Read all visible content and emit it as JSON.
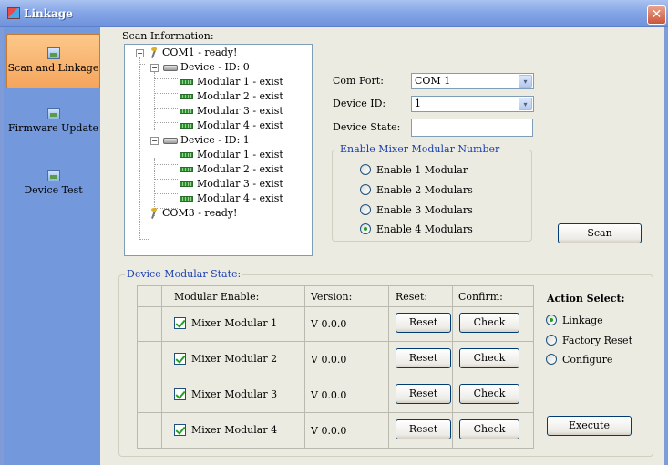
{
  "window": {
    "title": "Linkage",
    "close_glyph": "✕"
  },
  "sidebar": {
    "items": [
      {
        "label": "Scan and Linkage",
        "icon": "image-icon",
        "active": true
      },
      {
        "label": "Firmware Update",
        "icon": "image-icon",
        "active": false
      },
      {
        "label": "Device Test",
        "icon": "image-icon",
        "active": false
      }
    ]
  },
  "scan": {
    "section_label": "Scan Information:",
    "tree": [
      {
        "label": "COM1 - ready!"
      },
      {
        "label": "Device - ID: 0"
      },
      {
        "label": "Modular 1 - exist"
      },
      {
        "label": "Modular 2 - exist"
      },
      {
        "label": "Modular 3 - exist"
      },
      {
        "label": "Modular 4 - exist"
      },
      {
        "label": "Device - ID: 1"
      },
      {
        "label": "Modular 1 - exist"
      },
      {
        "label": "Modular 2 - exist"
      },
      {
        "label": "Modular 3 - exist"
      },
      {
        "label": "Modular 4 - exist"
      },
      {
        "label": "COM3 - ready!"
      }
    ],
    "expander_glyph": "−",
    "com_port_label": "Com Port:",
    "com_port_value": "COM 1",
    "device_id_label": "Device ID:",
    "device_id_value": "1",
    "device_state_label": "Device State:",
    "device_state_value": "",
    "dropdown_glyph": "▾",
    "mixer_group_title": "Enable Mixer Modular Number",
    "mixer_options": [
      {
        "label": "Enable 1 Modular",
        "selected": false
      },
      {
        "label": "Enable 2 Modulars",
        "selected": false
      },
      {
        "label": "Enable 3 Modulars",
        "selected": false
      },
      {
        "label": "Enable 4 Modulars",
        "selected": true
      }
    ],
    "scan_button": "Scan"
  },
  "modular_state": {
    "group_title": "Device Modular State:",
    "headers": {
      "enable": "Modular Enable:",
      "version": "Version:",
      "reset": "Reset:",
      "confirm": "Confirm:"
    },
    "rows": [
      {
        "name": "Mixer Modular 1",
        "checked": true,
        "version": "V 0.0.0",
        "reset": "Reset",
        "confirm": "Check"
      },
      {
        "name": "Mixer Modular 2",
        "checked": true,
        "version": "V 0.0.0",
        "reset": "Reset",
        "confirm": "Check"
      },
      {
        "name": "Mixer Modular 3",
        "checked": true,
        "version": "V 0.0.0",
        "reset": "Reset",
        "confirm": "Check"
      },
      {
        "name": "Mixer Modular 4",
        "checked": true,
        "version": "V 0.0.0",
        "reset": "Reset",
        "confirm": "Check"
      }
    ],
    "action_title": "Action Select:",
    "actions": [
      {
        "label": "Linkage",
        "selected": true
      },
      {
        "label": "Factory Reset",
        "selected": false
      },
      {
        "label": "Configure",
        "selected": false
      }
    ],
    "execute_button": "Execute"
  },
  "colors": {
    "titlebar": "#86a6e6",
    "sidebar": "#7398dc",
    "active_nav": "#f5a55c",
    "panel": "#ecebe2",
    "group_title": "#1a3fb0",
    "check_green": "#21a121"
  }
}
